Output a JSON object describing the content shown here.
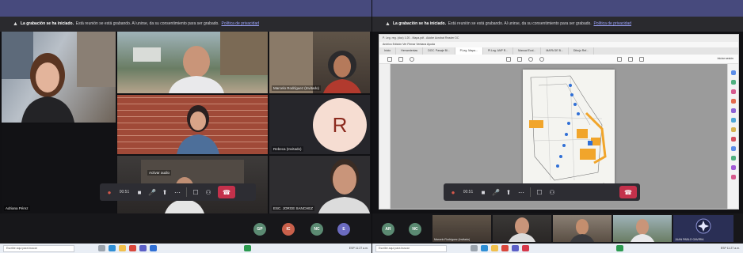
{
  "banner": {
    "bold": "La grabación se ha iniciado.",
    "text": "Está reunión se está grabando. Al unirse, da su consentimiento para ser grabado.",
    "link": "Política de privacidad"
  },
  "left_screen": {
    "tiles": [
      {
        "name": ""
      },
      {
        "name": ""
      },
      {
        "name": "Marcelo Rodríguez (Invitado)"
      },
      {
        "name": ""
      },
      {
        "name": "Rebeca (Invitado)",
        "initial": "R"
      },
      {
        "name": "Activar audio"
      },
      {
        "name": "ESC. JORGE SANCHEZ"
      },
      {
        "name": "Adriana Pérez"
      }
    ],
    "callbar": {
      "time": "00:51"
    },
    "avatars": [
      {
        "initials": "GP",
        "color": "#5b8a72"
      },
      {
        "initials": "IC",
        "color": "#c9604b"
      },
      {
        "initials": "NC",
        "color": "#5b8a72"
      },
      {
        "initials": "E",
        "color": "#6b6bc0"
      }
    ]
  },
  "right_screen": {
    "document": {
      "title": "P. Leg. reg. (doc) 1:20 - Mapa.pdf - Adobe Acrobat Reader DC",
      "menu": "Archivo   Edición   Ver   Firmar   Ventana   Ayuda",
      "tabs": [
        "Inicio",
        "Herramientas",
        "DOC. Pasaje Bl...",
        "P.Leg. Mapa...",
        "Pl.Leg. ANP R...",
        "Manual Ecol...",
        "MAPA DE B...",
        "Dibujo Ref..."
      ],
      "share": "Iniciar sesión"
    },
    "callbar": {
      "time": "00:51"
    },
    "avatars": [
      {
        "initials": "AR",
        "color": "#5b8a72"
      },
      {
        "initials": "NC",
        "color": "#5b8a72"
      }
    ],
    "minis": [
      {
        "name": "Marcelo Rodríguez (Invitado)"
      },
      {
        "name": ""
      },
      {
        "name": ""
      },
      {
        "name": ""
      },
      {
        "name": "JUAN PABLO GAVIRIA"
      }
    ]
  },
  "taskbar": {
    "search_placeholder": "Escribe aquí para buscar",
    "tray": "ESP  11:27 a.m."
  },
  "colors": {
    "teams_header": "#474a7d",
    "leave": "#c4314b",
    "avatar_r": "#f7e0d6"
  }
}
